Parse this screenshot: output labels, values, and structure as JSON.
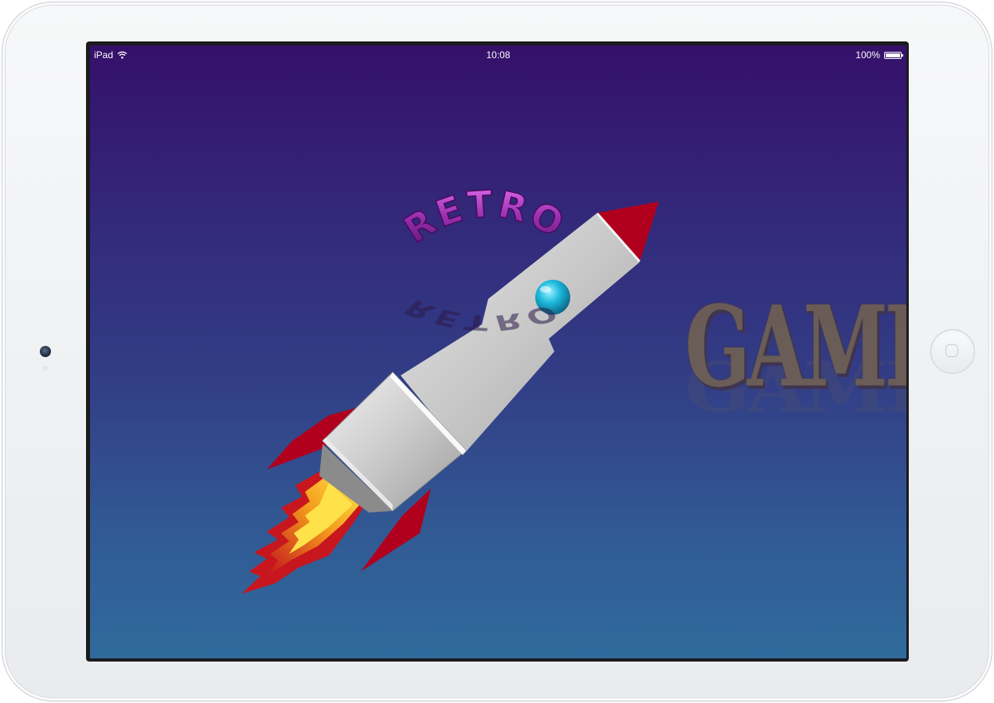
{
  "device": {
    "model": "iPad"
  },
  "status_bar": {
    "carrier": "iPad",
    "time": "10:08",
    "battery": "100%",
    "battery_level": 1.0
  },
  "game": {
    "title_top": "RETRO",
    "title_side": "GAMES"
  },
  "icons": {
    "wifi": "wifi-icon",
    "battery": "battery-icon",
    "camera": "front-camera",
    "home": "home-button"
  },
  "colors": {
    "background_top": "#35106a",
    "background_bottom": "#2f6b9c",
    "rocket_body": "#c9c9c9",
    "rocket_fins": "#b0001e",
    "orb": "#1ab4d8",
    "retro_text": "#8d2a9e",
    "games_text": "#6d5e55"
  }
}
